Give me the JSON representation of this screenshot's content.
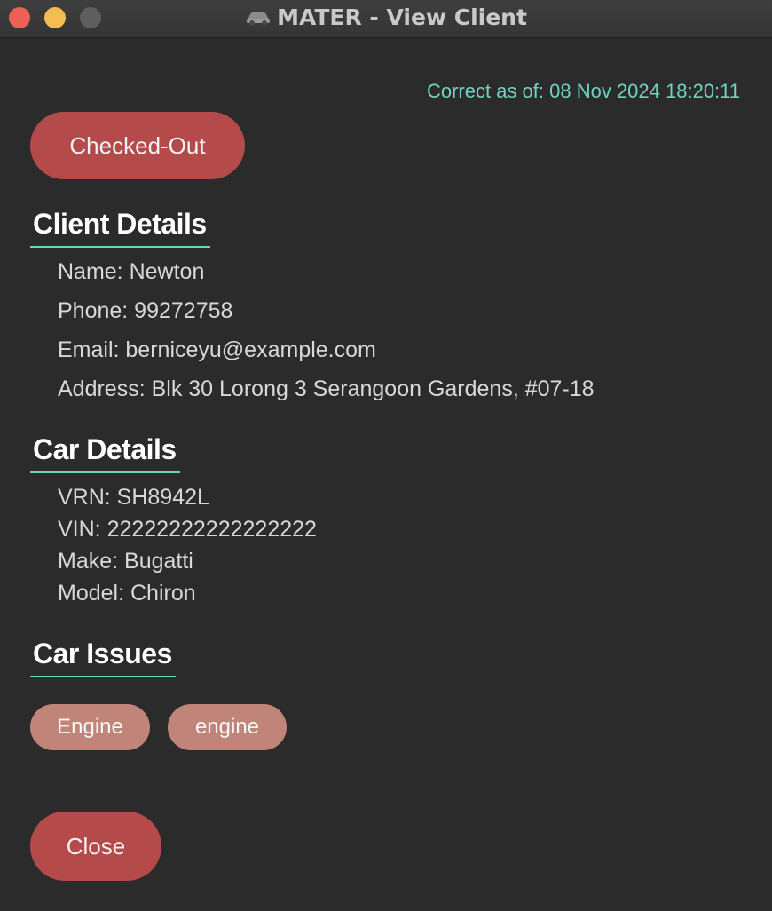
{
  "window": {
    "title": "MATER - View Client",
    "app_icon": "car-icon"
  },
  "timestamp": "Correct as of: 08 Nov 2024 18:20:11",
  "status_button": "Checked-Out",
  "client_details": {
    "heading": "Client Details",
    "name": "Name: Newton",
    "phone": "Phone: 99272758",
    "email": "Email: berniceyu@example.com",
    "address": "Address: Blk 30 Lorong 3 Serangoon Gardens, #07-18"
  },
  "car_details": {
    "heading": "Car Details",
    "vrn": "VRN: SH8942L",
    "vin": "VIN: 22222222222222222",
    "make": "Make: Bugatti",
    "model": "Model: Chiron"
  },
  "car_issues": {
    "heading": "Car Issues",
    "tags": [
      "Engine",
      "engine"
    ]
  },
  "close_button": "Close",
  "colors": {
    "background": "#2b2b2b",
    "accent": "#6fd3be",
    "button": "#b44a4a",
    "tag": "#c08478"
  }
}
